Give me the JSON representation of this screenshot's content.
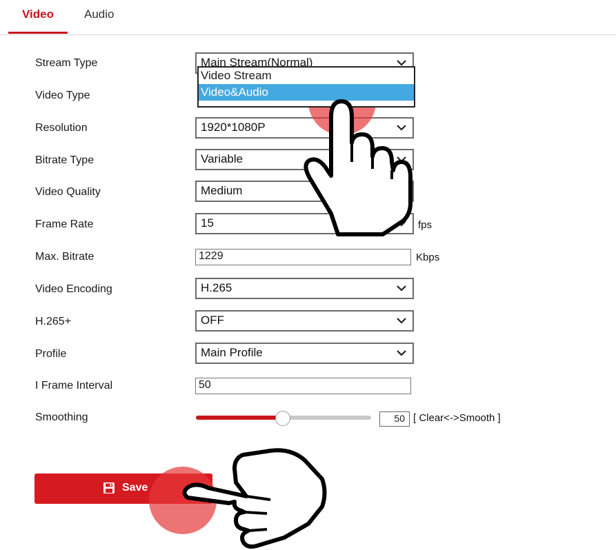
{
  "tabs": {
    "video": "Video",
    "audio": "Audio"
  },
  "form": {
    "stream_type": {
      "label": "Stream Type",
      "value": "Main Stream(Normal)"
    },
    "video_type": {
      "label": "Video Type",
      "options": [
        "Video Stream",
        "Video&Audio"
      ],
      "highlighted_option": "Video&Audio"
    },
    "resolution": {
      "label": "Resolution",
      "value": "1920*1080P"
    },
    "bitrate_type": {
      "label": "Bitrate Type",
      "value": "Variable"
    },
    "video_quality": {
      "label": "Video Quality",
      "value": "Medium"
    },
    "frame_rate": {
      "label": "Frame Rate",
      "value": "15",
      "unit": "fps"
    },
    "max_bitrate": {
      "label": "Max. Bitrate",
      "value": "1229",
      "unit": "Kbps"
    },
    "video_encoding": {
      "label": "Video Encoding",
      "value": "H.265"
    },
    "h265plus": {
      "label": "H.265+",
      "value": "OFF"
    },
    "profile": {
      "label": "Profile",
      "value": "Main Profile"
    },
    "i_frame_interval": {
      "label": "I Frame Interval",
      "value": "50"
    },
    "smoothing": {
      "label": "Smoothing",
      "value": "50",
      "level": 50,
      "hint": "[ Clear<->Smooth ]"
    }
  },
  "save_button": {
    "label": "Save"
  },
  "colors": {
    "accent": "#c8161d",
    "selection": "#44a9e0",
    "tap_indicator": "#e53939"
  },
  "icons": [
    "chevron-down-icon",
    "save-icon",
    "pointer-hand-icon"
  ]
}
